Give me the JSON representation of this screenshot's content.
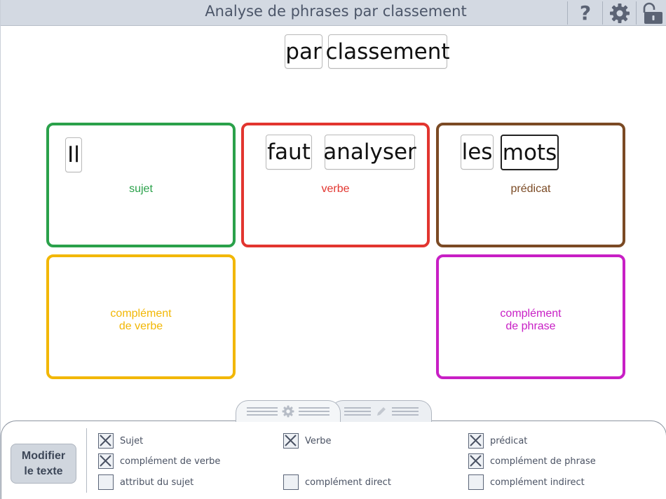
{
  "app": {
    "title": "Analyse de phrases par classement"
  },
  "toolbar": {
    "help_label": "?",
    "help_icon": "help-icon",
    "settings_icon": "gear-icon",
    "lock_icon": "lock-icon"
  },
  "sentence_pool": {
    "tokens": [
      "par",
      "classement"
    ]
  },
  "categories": [
    {
      "id": "sujet",
      "label": "sujet",
      "color": "#2aa14a",
      "tokens": [
        "Il"
      ]
    },
    {
      "id": "verbe",
      "label": "verbe",
      "color": "#e2352f",
      "tokens": [
        "faut",
        "analyser"
      ]
    },
    {
      "id": "predicat",
      "label": "prédicat",
      "color": "#7b4a24",
      "tokens": [
        "les",
        "mots"
      ]
    },
    {
      "id": "complement-verbe",
      "label_line1": "complément",
      "label_line2": "de verbe",
      "color": "#f2b705",
      "tokens": []
    },
    {
      "id": "complement-phrase",
      "label_line1": "complément",
      "label_line2": "de phrase",
      "color": "#c81fc5",
      "tokens": []
    }
  ],
  "panel": {
    "tabs": [
      {
        "name": "settings-tab",
        "icon": "gear-icon"
      },
      {
        "name": "edit-tab",
        "icon": "pencil-icon"
      }
    ],
    "modify_button": {
      "line1": "Modifier",
      "line2": "le texte"
    },
    "options": [
      {
        "label": "Sujet",
        "checked": true
      },
      {
        "label": "Verbe",
        "checked": true
      },
      {
        "label": "prédicat",
        "checked": true
      },
      {
        "label": "complément de verbe",
        "checked": true
      },
      {
        "label": "complément de phrase",
        "checked": true
      },
      {
        "label": "attribut du sujet",
        "checked": false
      },
      {
        "label": "complément direct",
        "checked": false
      },
      {
        "label": "complément indirect",
        "checked": false
      }
    ]
  },
  "colors": {
    "topbar_bg": "#d3d9e2",
    "title_text": "#4c5669",
    "panel_button_bg": "#d0d6de"
  }
}
